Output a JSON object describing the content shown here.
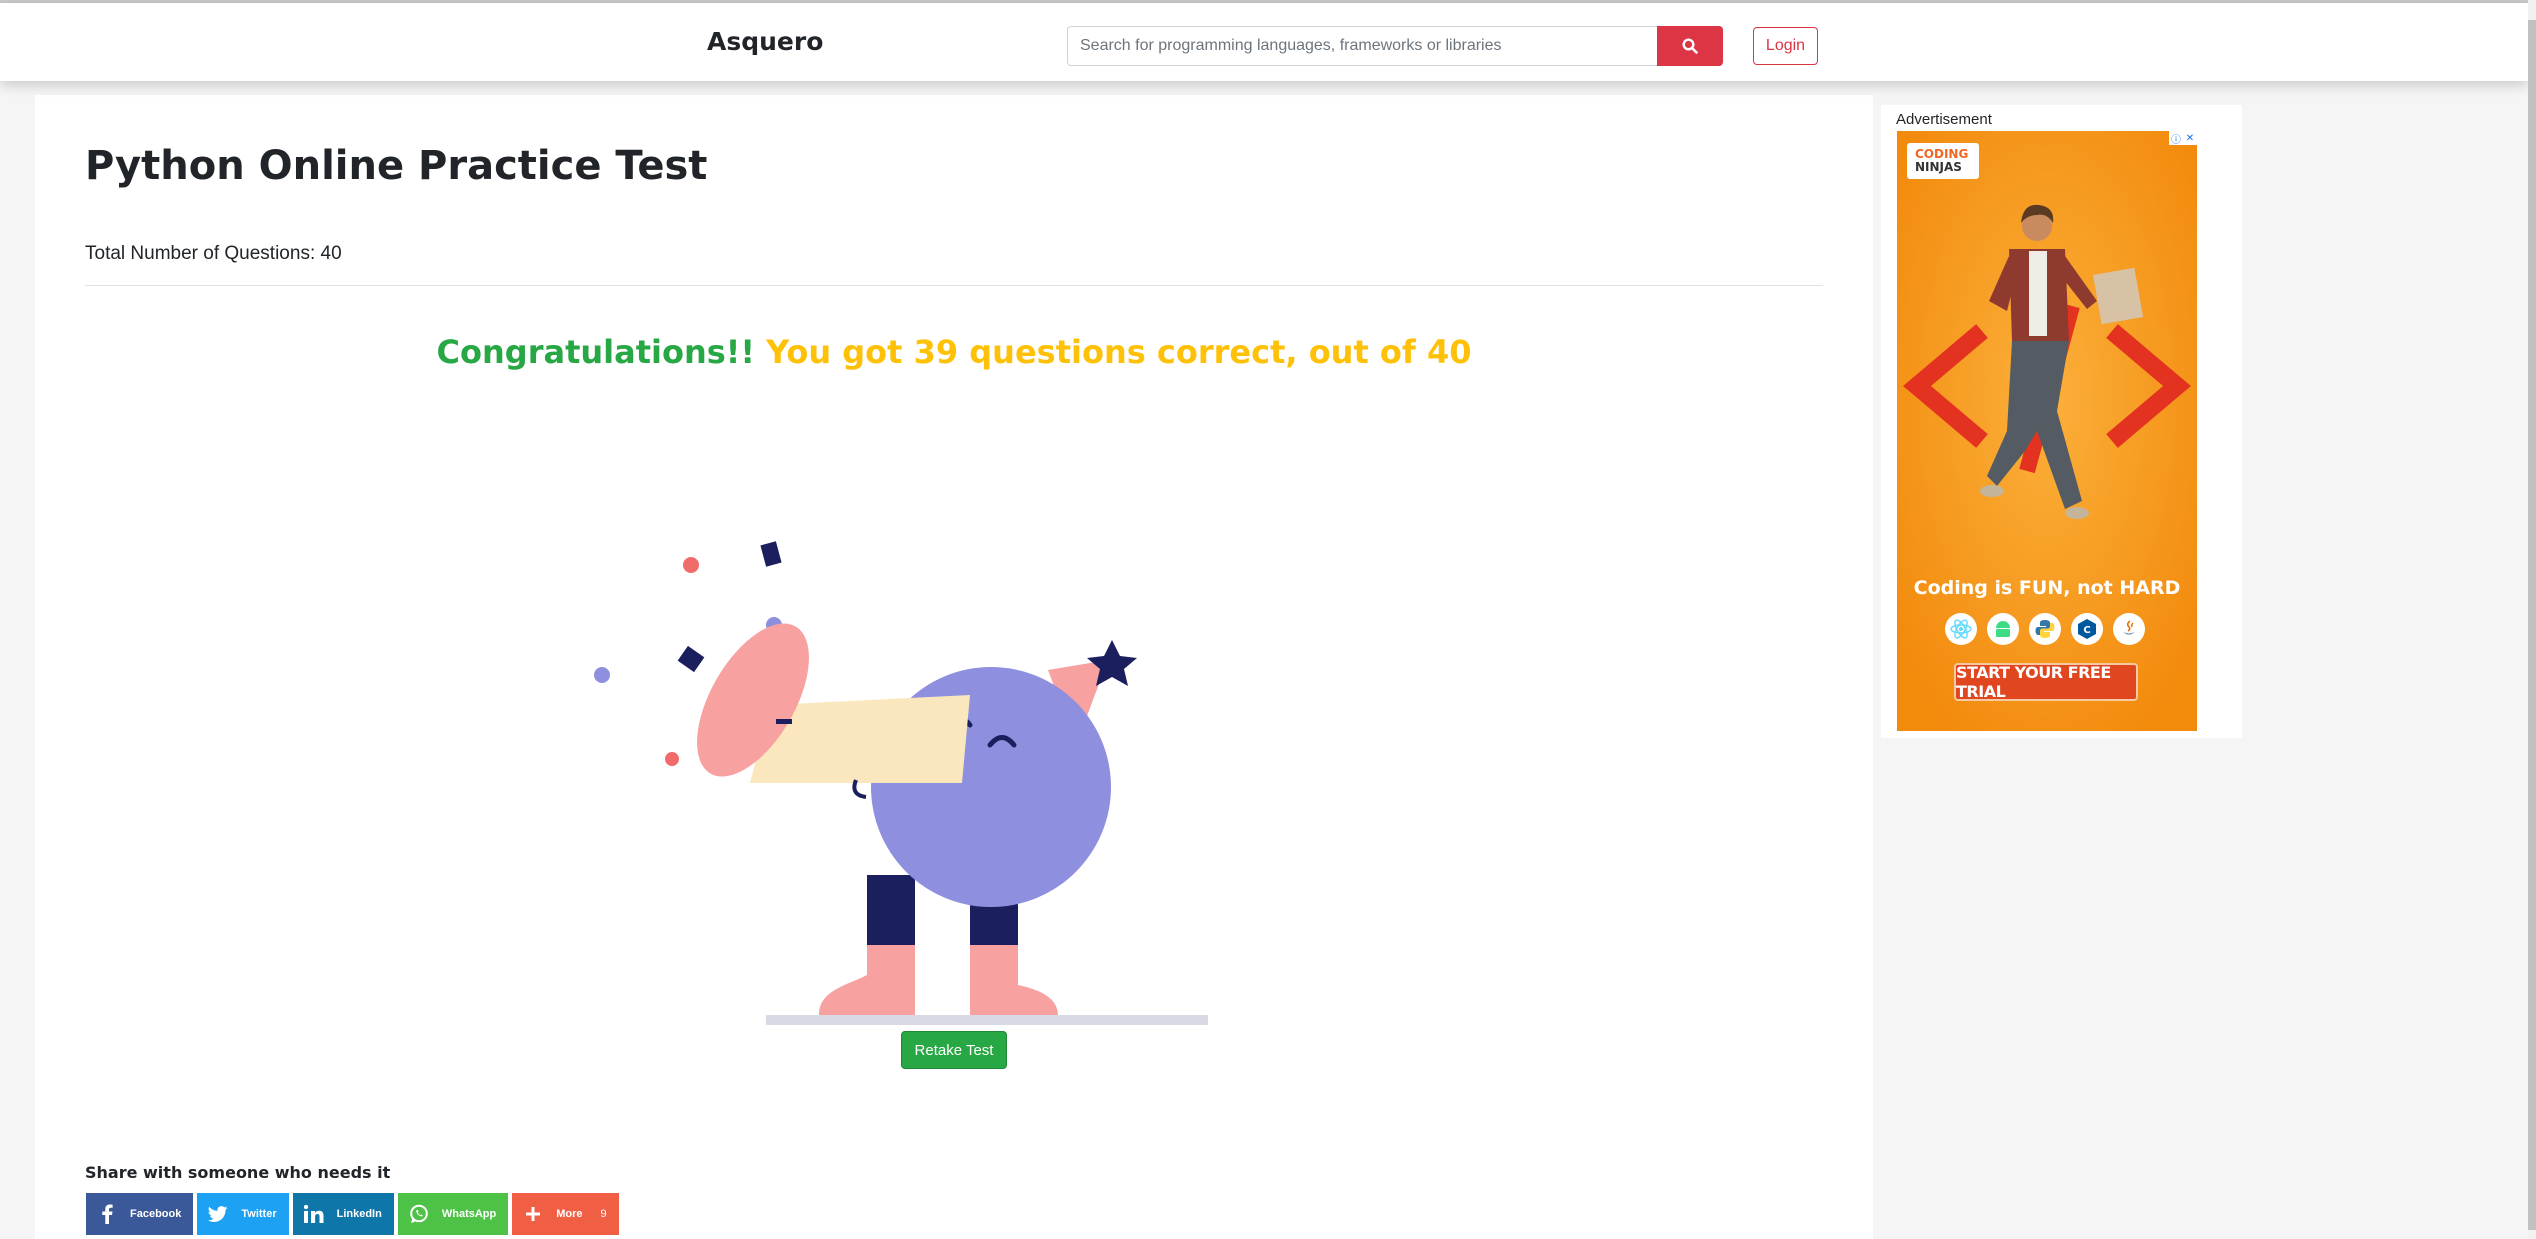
{
  "header": {
    "brand": "Asquero",
    "search_placeholder": "Search for programming languages, frameworks or libraries",
    "login_label": "Login"
  },
  "main": {
    "title": "Python Online Practice Test",
    "total_questions_text": "Total Number of Questions: 40",
    "result_congrats": "Congratulations!!",
    "result_score": "You got 39 questions correct, out of 40",
    "retake_label": "Retake Test"
  },
  "share": {
    "title": "Share with someone who needs it",
    "buttons": [
      {
        "label": "Facebook",
        "icon": "facebook-icon",
        "color": "#3b5998"
      },
      {
        "label": "Twitter",
        "icon": "twitter-icon",
        "color": "#1da1f2"
      },
      {
        "label": "LinkedIn",
        "icon": "linkedin-icon",
        "color": "#0e76a8"
      },
      {
        "label": "WhatsApp",
        "icon": "whatsapp-icon",
        "color": "#4dc247"
      },
      {
        "label": "More",
        "icon": "plus-icon",
        "color": "#f05e44",
        "count": "9"
      }
    ]
  },
  "sidebar": {
    "ad_label": "Advertisement",
    "ad": {
      "logo_line1": "CODING",
      "logo_line2": "NINJAS",
      "headline": "Coding is FUN, not HARD",
      "cta": "START YOUR FREE TRIAL",
      "tech_icons": [
        "react-icon",
        "android-icon",
        "python-icon",
        "c-plus-plus-icon",
        "java-icon"
      ]
    }
  },
  "colors": {
    "accent_red": "#dc3545",
    "success_green": "#28a745",
    "score_yellow": "#ffc107",
    "ad_orange": "#f39c12"
  }
}
